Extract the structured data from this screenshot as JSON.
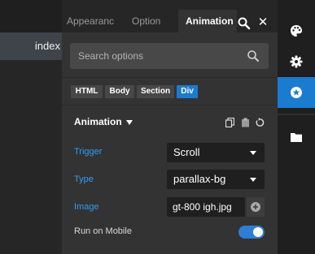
{
  "editor": {
    "open_tab": "index"
  },
  "panel": {
    "tabs": [
      "Appearance",
      "Option",
      "Animation"
    ],
    "active_tab": "Animation",
    "search": {
      "placeholder": "Search options"
    },
    "breadcrumbs": [
      "HTML",
      "Body",
      "Section",
      "Div"
    ],
    "active_breadcrumb": "Div",
    "section": {
      "title": "Animation"
    },
    "fields": {
      "trigger": {
        "label": "Trigger",
        "value": "Scroll"
      },
      "type": {
        "label": "Type",
        "value": "parallax-bg"
      },
      "image": {
        "label": "Image",
        "value": "gt-800 igh.jpg"
      },
      "run_on_mobile": {
        "label": "Run on Mobile",
        "enabled": true
      }
    }
  },
  "right_toolbar": {
    "icons": [
      "palette-icon",
      "gear-icon",
      "star-badge-icon",
      "folder-icon"
    ],
    "active": "star-badge-icon"
  },
  "colors": {
    "accent": "#1b7bd1",
    "label_blue": "#2d9ef5",
    "panel_bg": "#333333"
  }
}
